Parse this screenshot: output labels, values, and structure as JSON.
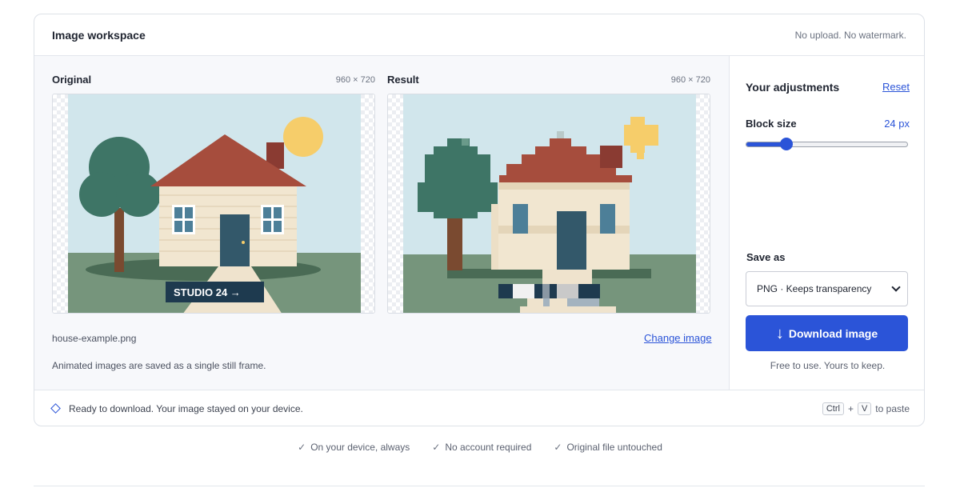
{
  "workspace": {
    "title": "Image workspace",
    "note": "No upload. No watermark."
  },
  "original": {
    "label": "Original",
    "dimensions": "960 × 720",
    "overlay_text": "STUDIO 24 →"
  },
  "result": {
    "label": "Result",
    "dimensions": "960 × 720"
  },
  "file": {
    "name": "house-example.png",
    "change_label": "Change image",
    "animated_note": "Animated images are saved as a single still frame."
  },
  "adjustments": {
    "title": "Your adjustments",
    "reset_label": "Reset",
    "block_size_label": "Block size",
    "block_size_value": "24 px",
    "slider_fraction": 0.25
  },
  "save": {
    "label": "Save as",
    "selected_option": "PNG · Keeps transparency",
    "download_label": "Download image",
    "download_icon": "arrow-down-icon",
    "free_note": "Free to use. Yours to keep."
  },
  "footer": {
    "status": "Ready to download. Your image stayed on your device.",
    "key1": "Ctrl",
    "plus": "+",
    "key2": "V",
    "paste_suffix": "to paste"
  },
  "badges": [
    "On your device, always",
    "No account required",
    "Original file untouched"
  ],
  "colors": {
    "accent": "#2b54d8",
    "sky": "#d1e6ec",
    "grass": "#76957c",
    "roof": "#a64d3d",
    "wall": "#f1e6d0",
    "door": "#33586a",
    "tree": "#3e7566",
    "sun": "#f6cd6a"
  }
}
